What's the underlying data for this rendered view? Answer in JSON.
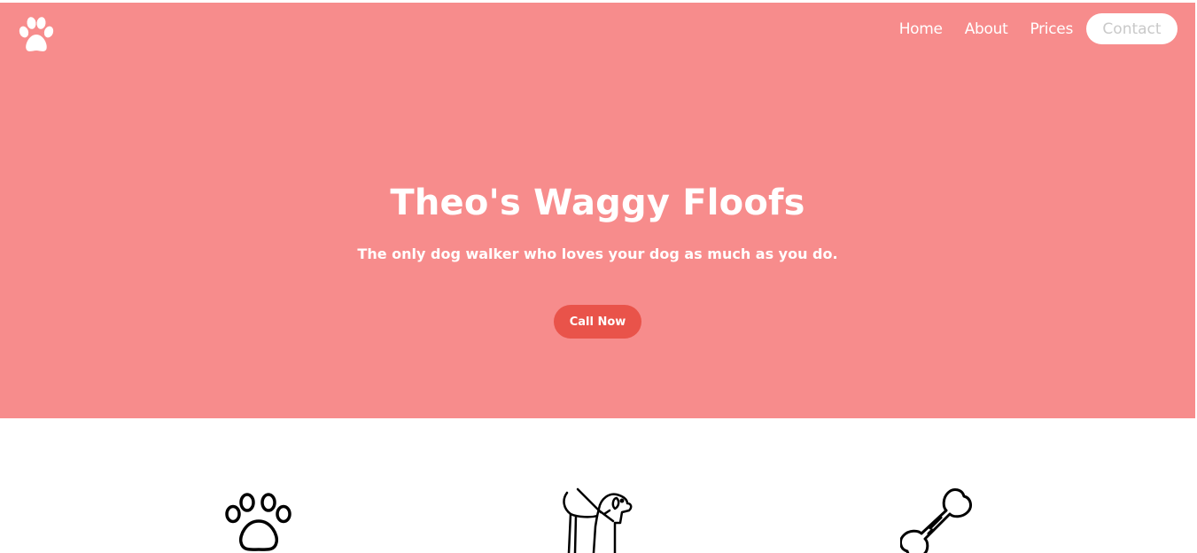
{
  "nav": {
    "home": "Home",
    "about": "About",
    "prices": "Prices",
    "contact": "Contact"
  },
  "hero": {
    "title": "Theo's Waggy Floofs",
    "subtitle": "The only dog walker who loves your dog as much as you do.",
    "cta": "Call Now"
  },
  "icons": {
    "logo": "paw-icon",
    "features": [
      "paw-print-icon",
      "dog-on-leash-icon",
      "bone-icon"
    ]
  },
  "colors": {
    "hero_bg": "#f78c8c",
    "cta_bg": "#e9534a",
    "text_light": "#ffffff"
  }
}
